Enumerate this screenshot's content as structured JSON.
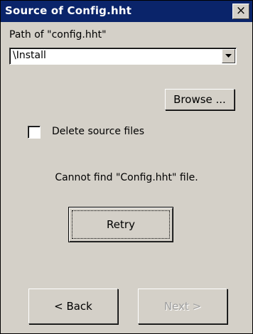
{
  "window": {
    "title": "Source of Config.hht",
    "close_label": "×"
  },
  "path": {
    "label": "Path of \"config.hht\"",
    "value": "\\Install",
    "dropdown_icon": "chevron-down-icon"
  },
  "browse_label": "Browse ...",
  "delete_source": {
    "label": "Delete source files",
    "checked": false
  },
  "message": "Cannot find \"Config.hht\" file.",
  "retry_label": "Retry",
  "nav": {
    "back_label": "< Back",
    "next_label": "Next >",
    "next_enabled": false
  },
  "colors": {
    "title_bar": "#0a246a",
    "face": "#d4d0c8",
    "disabled_text": "#a0a0a0"
  }
}
